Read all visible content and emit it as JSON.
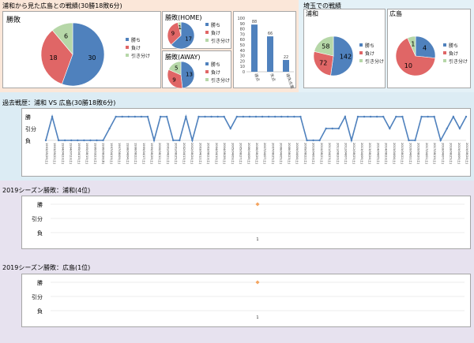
{
  "colors": {
    "win": "#4f81bd",
    "lose": "#e06666",
    "draw": "#b6d7a8",
    "line": "#4f81bd",
    "marker": "#f4a460",
    "bg_top_left": "#fbe7d9",
    "bg_top_right": "#e4f1f7",
    "bg_mid": "#dcecf4",
    "bg_bottom": "#e7e2ef"
  },
  "sections": {
    "overall_title": "浦和から見た広島との戦績(30勝18敗6分)",
    "saitama_title": "埼玉での戦績",
    "history_title": "過去戦歴：浦和 VS 広島(30勝18敗6分)",
    "season_urawa_title": "2019シーズン勝敗：浦和(4位)",
    "season_hiroshima_title": "2019シーズン勝敗：広島(1位)"
  },
  "legend": {
    "win": "勝ち",
    "lose": "負け",
    "draw": "引き分け"
  },
  "chart_data": [
    {
      "type": "pie",
      "title": "勝敗",
      "categories": [
        "勝ち",
        "負け",
        "引き分け"
      ],
      "values": [
        30,
        18,
        6
      ]
    },
    {
      "type": "pie",
      "title": "勝敗(HOME)",
      "categories": [
        "勝ち",
        "負け",
        "引き分け"
      ],
      "values": [
        17,
        9,
        1
      ]
    },
    {
      "type": "pie",
      "title": "勝敗(AWAY)",
      "categories": [
        "勝ち",
        "負け",
        "引き分け"
      ],
      "values": [
        13,
        9,
        5
      ]
    },
    {
      "type": "bar",
      "categories": [
        "得点",
        "失点",
        "得失点差"
      ],
      "values": [
        88,
        66,
        22
      ],
      "ylim": [
        0,
        100
      ],
      "yticks": [
        0,
        10,
        20,
        30,
        40,
        50,
        60,
        70,
        80,
        90,
        100
      ]
    },
    {
      "type": "pie",
      "title": "浦和",
      "categories": [
        "勝ち",
        "負け",
        "引き分け"
      ],
      "values": [
        142,
        72,
        58
      ]
    },
    {
      "type": "pie",
      "title": "広島",
      "categories": [
        "勝ち",
        "負け",
        "引き分け"
      ],
      "values": [
        4,
        10,
        1
      ]
    },
    {
      "type": "line",
      "title": "過去戦歴：浦和 VS 広島(30勝18敗6分)",
      "y_categories": [
        "負",
        "引分",
        "勝"
      ],
      "values": [
        0,
        2,
        0,
        0,
        0,
        0,
        0,
        0,
        0,
        0,
        1,
        2,
        2,
        2,
        2,
        2,
        2,
        0,
        2,
        2,
        0,
        0,
        2,
        0,
        2,
        2,
        2,
        2,
        2,
        1,
        2,
        2,
        2,
        2,
        2,
        2,
        2,
        2,
        2,
        2,
        2,
        0,
        0,
        0,
        1,
        1,
        1,
        2,
        0,
        2,
        2,
        2,
        2,
        2,
        1,
        2,
        2,
        0,
        0,
        2,
        2,
        2,
        0,
        1,
        2,
        1,
        2
      ],
      "x": [
        "1993/05/26(土)",
        "1993/09/22(土)",
        "1994/04/23(土)",
        "1994/07/23(土)",
        "1995/04/15(土)",
        "1995/08/19(土)",
        "1996/03/23(土)",
        "1996/08/28(水)",
        "1997/04/19(土)",
        "1997/08/09(土)",
        "1998/04/04(土)",
        "1998/08/22(土)",
        "1999/04/17(土)",
        "1999/08/28(土)",
        "2000/08/12(土)",
        "2001/04/21(土)",
        "2001/08/25(土)",
        "2002/04/13(土)",
        "2002/08/24(土)",
        "2003/04/12(土)",
        "2003/08/23(土)",
        "2004/04/10(土)",
        "2004/08/28(土)",
        "2005/04/09(土)",
        "2005/08/27(土)",
        "2006/04/08(土)",
        "2006/08/26(土)",
        "2007/04/07(土)",
        "2007/08/25(土)",
        "2008/04/05(土)",
        "2008/08/23(土)",
        "2009/04/04(土)",
        "2009/08/22(土)",
        "2010/04/03(土)",
        "2010/08/21(土)",
        "2011/04/23(土)",
        "2011/08/20(土)",
        "2012/04/07(土)",
        "2012/08/25(土)",
        "2013/04/06(土)",
        "2013/08/24(土)",
        "2014/04/05(土)",
        "2014/08/23(土)",
        "2015/04/04(土)",
        "2015/08/22(土)",
        "2016/04/02(土)",
        "2016/08/20(土)",
        "2017/04/01(土)",
        "2017/08/19(土)",
        "2018/04/07(土)",
        "2018/08/25(土)",
        "2019/04/06(土)",
        "2019/08/24(土)"
      ]
    },
    {
      "type": "scatter",
      "title": "2019シーズン勝敗：浦和(4位)",
      "y_categories": [
        "負",
        "引分",
        "勝"
      ],
      "x": [
        1
      ],
      "values": [
        2
      ]
    },
    {
      "type": "scatter",
      "title": "2019シーズン勝敗：広島(1位)",
      "y_categories": [
        "負",
        "引分",
        "勝"
      ],
      "x": [
        1
      ],
      "values": [
        2
      ]
    }
  ]
}
